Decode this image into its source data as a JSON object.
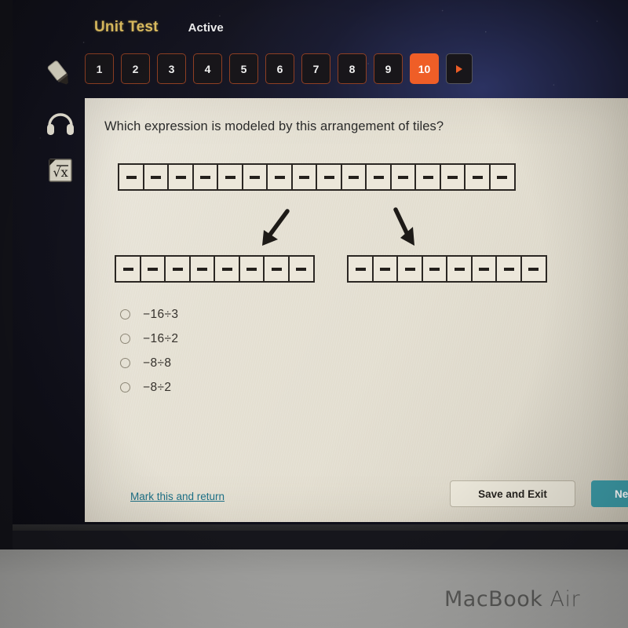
{
  "device": {
    "brand_label_bold": "MacBook",
    "brand_label_thin": " Air"
  },
  "header": {
    "title": "Unit Test",
    "status": "Active"
  },
  "question_nav": {
    "items": [
      "1",
      "2",
      "3",
      "4",
      "5",
      "6",
      "7",
      "8",
      "9",
      "10"
    ],
    "current": "10",
    "next_icon": "triangle-right-icon",
    "active_color": "#ef5e27",
    "border_color": "#8f3f23"
  },
  "toolbar": {
    "items": [
      {
        "name": "highlighter-icon",
        "label": "Highlighter"
      },
      {
        "name": "headphones-icon",
        "label": "Audio"
      },
      {
        "name": "calculator-icon",
        "label": "Calculator"
      }
    ]
  },
  "question": {
    "text": "Which expression is modeled by this arrangement of tiles?",
    "tiles": {
      "top_row_count": 16,
      "bottom_left_count": 8,
      "bottom_right_count": 8,
      "tile_symbol": "minus"
    },
    "arrows": [
      {
        "name": "arrow-down-left-icon",
        "direction": "down-left"
      },
      {
        "name": "arrow-down-right-icon",
        "direction": "down-right"
      }
    ],
    "options": [
      {
        "label": "−16÷3",
        "selected": false
      },
      {
        "label": "−16÷2",
        "selected": false
      },
      {
        "label": "−8÷8",
        "selected": false
      },
      {
        "label": "−8÷2",
        "selected": false
      }
    ]
  },
  "footer": {
    "mark_link": "Mark this and return",
    "save_button": "Save and Exit",
    "next_button": "Next",
    "next_color": "#3c9aa6"
  },
  "colors": {
    "card_background": "#e3ded0",
    "screen_background": "#141420",
    "title_gold": "#e7c664",
    "link_teal": "#1c6f85"
  }
}
